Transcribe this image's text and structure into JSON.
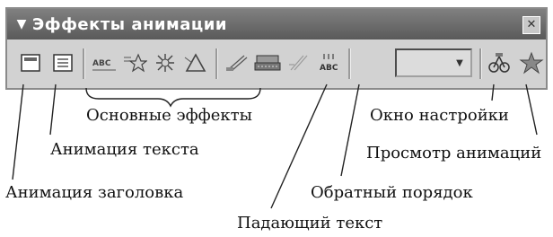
{
  "toolbar": {
    "title": "Эффекты анимации",
    "menu_arrow": "▼",
    "close_glyph": "✕"
  },
  "buttons": [
    {
      "name": "title-animation-button",
      "icon": "slide-title-icon"
    },
    {
      "name": "text-animation-button",
      "icon": "slide-text-icon"
    },
    {
      "name": "effect-drive-in-button",
      "icon": "car-text-icon",
      "glyph": "ABC"
    },
    {
      "name": "effect-flying-button",
      "icon": "star-icon"
    },
    {
      "name": "effect-camera-button",
      "icon": "burst-icon"
    },
    {
      "name": "effect-flash-button",
      "icon": "laser-text-icon"
    },
    {
      "name": "effect-typewriter-button",
      "icon": "typewriter-icon"
    },
    {
      "name": "effect-drop-in-button",
      "icon": "drop-in-text-icon"
    },
    {
      "name": "effect-laser-button",
      "icon": "laser-icon"
    },
    {
      "name": "reverse-order-button",
      "icon": "reverse-order-icon",
      "glyph": "ABC"
    },
    {
      "name": "settings-window-button",
      "icon": "settings-icon"
    },
    {
      "name": "preview-animation-button",
      "icon": "preview-star-icon"
    }
  ],
  "labels": {
    "basic_effects": "Основные эффекты",
    "text_animation": "Анимация текста",
    "title_animation": "Анимация заголовка",
    "falling_text": "Падающий текст",
    "settings_window": "Окно настройки",
    "preview_animation": "Просмотр анимаций",
    "reverse_order": "Обратный порядок"
  }
}
